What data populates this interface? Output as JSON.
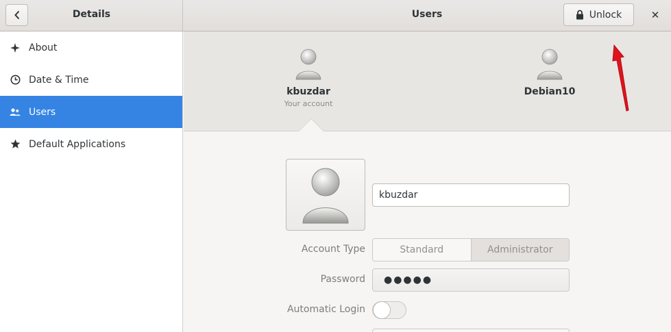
{
  "header": {
    "left_title": "Details",
    "title": "Users",
    "unlock_label": "Unlock",
    "close_label": "✕"
  },
  "sidebar": {
    "items": [
      {
        "label": "About",
        "icon": "star-sparkle-icon",
        "active": false
      },
      {
        "label": "Date & Time",
        "icon": "clock-icon",
        "active": false
      },
      {
        "label": "Users",
        "icon": "users-icon",
        "active": true
      },
      {
        "label": "Default Applications",
        "icon": "star-icon",
        "active": false
      }
    ]
  },
  "users": [
    {
      "name": "kbuzdar",
      "subtitle": "Your account"
    },
    {
      "name": "Debian10",
      "subtitle": ""
    }
  ],
  "account": {
    "name_value": "kbuzdar",
    "account_type_label": "Account Type",
    "account_type_options": [
      "Standard",
      "Administrator"
    ],
    "account_type_selected": "Administrator",
    "password_label": "Password",
    "password_value": "●●●●●",
    "auto_login_label": "Automatic Login",
    "auto_login_on": false
  },
  "colors": {
    "accent": "#3584e4",
    "annotation_arrow": "#e0141e"
  }
}
